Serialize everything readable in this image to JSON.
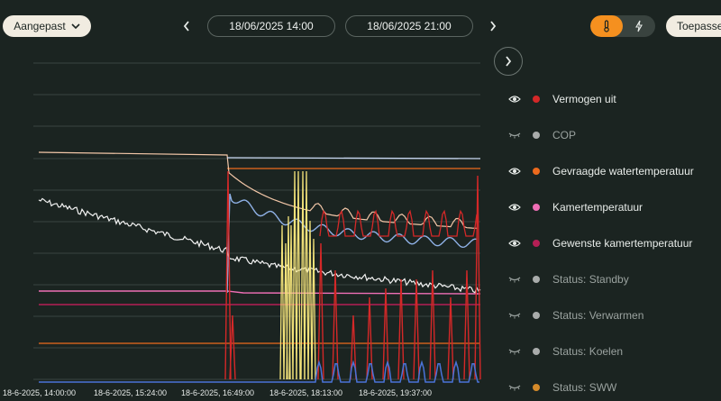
{
  "toolbar": {
    "preset_label": "Aangepast",
    "date_from": "18/06/2025 14:00",
    "date_to": "18/06/2025 21:00",
    "apply_label": "Toepassen",
    "mode_active": "temperature",
    "accent_color": "#f5901f"
  },
  "chart_data": {
    "type": "line",
    "x_ticks": [
      "18-6-2025, 14:00:00",
      "18-6-2025, 15:24:00",
      "18-6-2025, 16:49:00",
      "18-6-2025, 18:13:00",
      "18-6-2025, 19:37:00"
    ],
    "grid": true,
    "legend_position": "right"
  },
  "legend": {
    "items": [
      {
        "label": "Vermogen uit",
        "color": "#d42828",
        "visible": true
      },
      {
        "label": "COP",
        "color": "#a9acab",
        "visible": false
      },
      {
        "label": "Gevraagde watertemperatuur",
        "color": "#ec6a1d",
        "visible": true
      },
      {
        "label": "Kamertemperatuur",
        "color": "#ef6fb6",
        "visible": true
      },
      {
        "label": "Gewenste kamertemperatuur",
        "color": "#b51f55",
        "visible": true
      },
      {
        "label": "Status: Standby",
        "color": "#a9acab",
        "visible": false
      },
      {
        "label": "Status: Verwarmen",
        "color": "#a9acab",
        "visible": false
      },
      {
        "label": "Status: Koelen",
        "color": "#a9acab",
        "visible": false
      },
      {
        "label": "Status: SWW",
        "color": "#d58a2a",
        "visible": false
      }
    ]
  }
}
